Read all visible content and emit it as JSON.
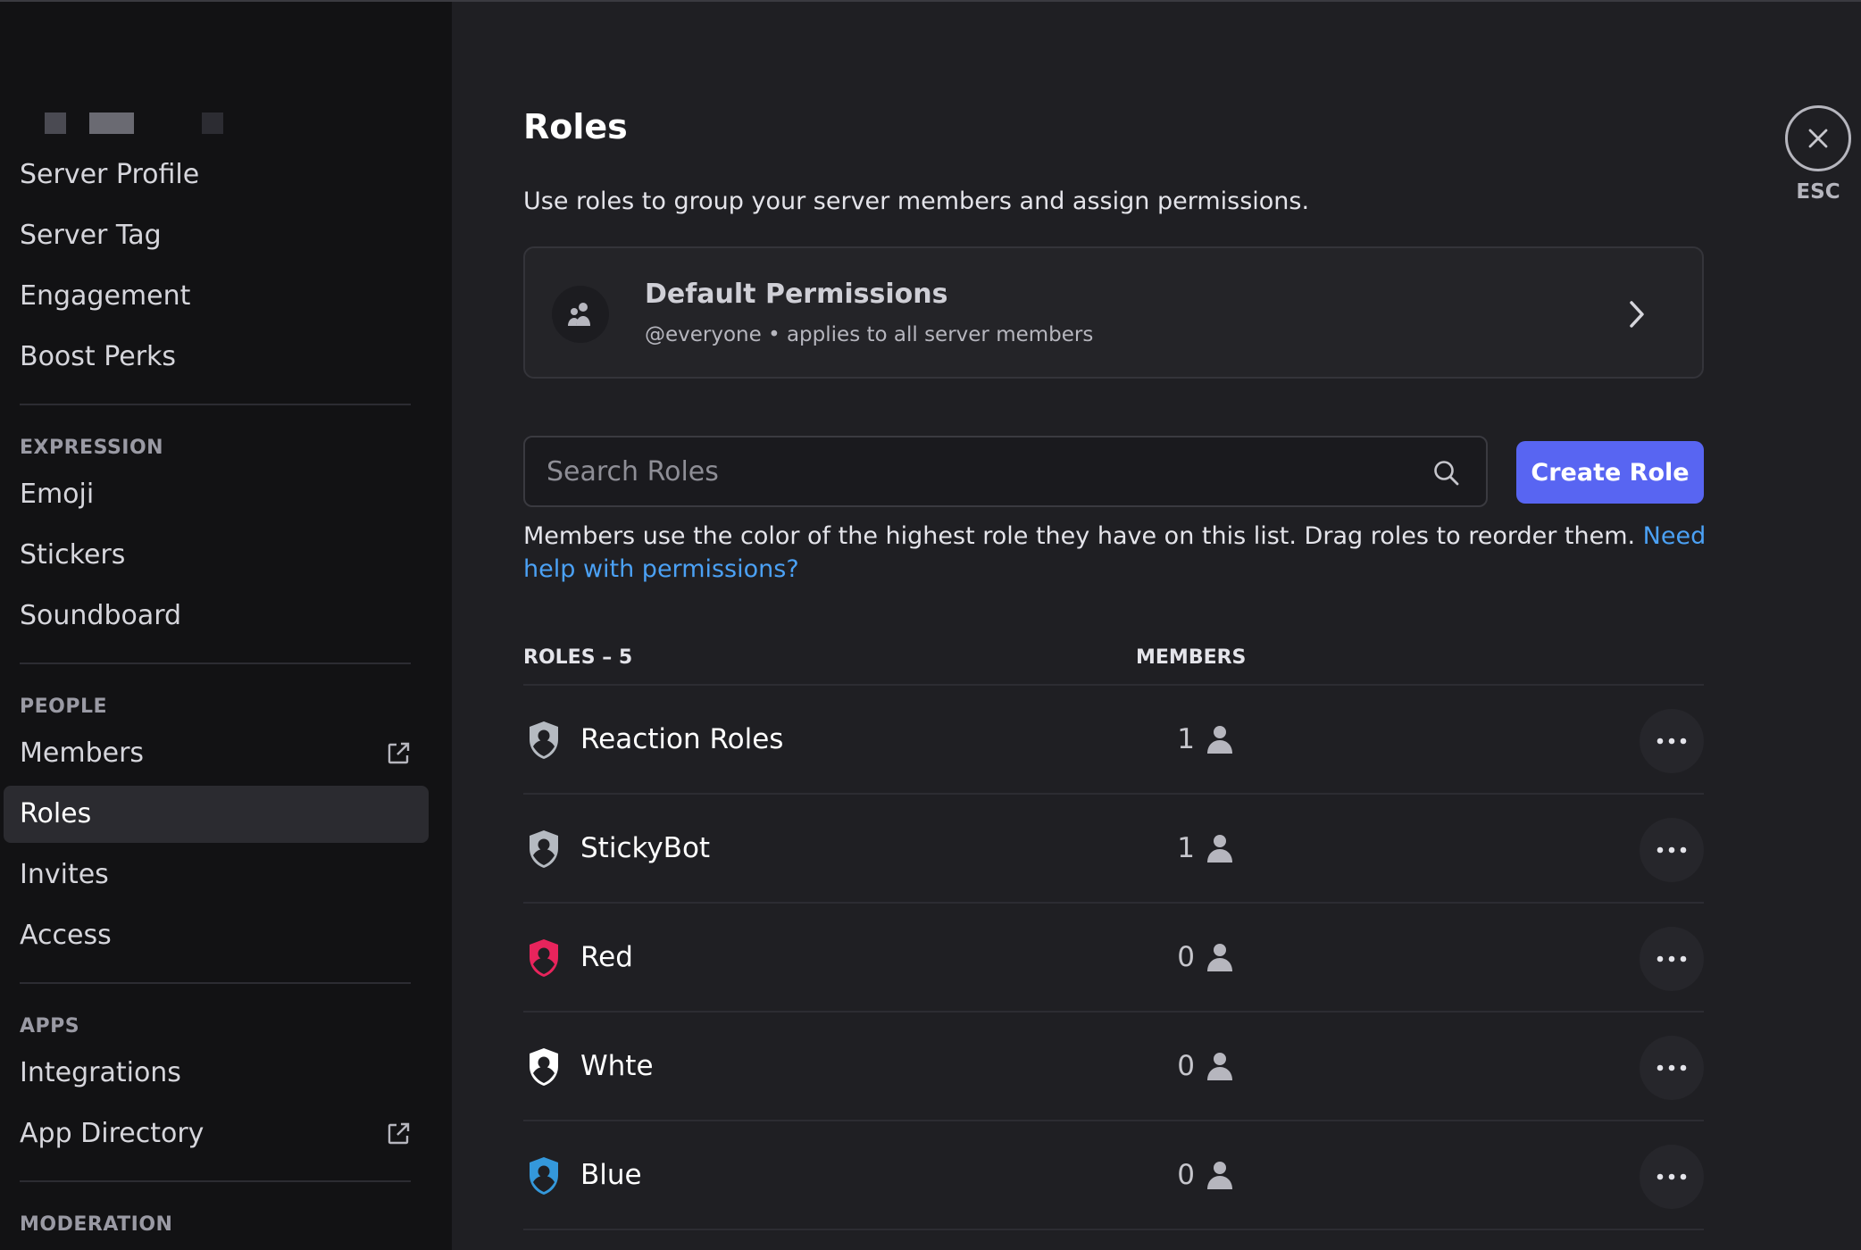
{
  "sidebar": {
    "items_top": [
      {
        "label": "Server Profile"
      },
      {
        "label": "Server Tag"
      },
      {
        "label": "Engagement"
      },
      {
        "label": "Boost Perks"
      }
    ],
    "expression": {
      "header": "EXPRESSION",
      "items": [
        {
          "label": "Emoji"
        },
        {
          "label": "Stickers"
        },
        {
          "label": "Soundboard"
        }
      ]
    },
    "people": {
      "header": "PEOPLE",
      "items": [
        {
          "label": "Members"
        },
        {
          "label": "Roles"
        },
        {
          "label": "Invites"
        },
        {
          "label": "Access"
        }
      ]
    },
    "apps": {
      "header": "APPS",
      "items": [
        {
          "label": "Integrations"
        },
        {
          "label": "App Directory"
        }
      ]
    },
    "moderation": {
      "header": "MODERATION"
    }
  },
  "main": {
    "title": "Roles",
    "description": "Use roles to group your server members and assign permissions.",
    "default_permissions": {
      "title": "Default Permissions",
      "subtitle": "@everyone • applies to all server members"
    },
    "search": {
      "placeholder": "Search Roles"
    },
    "create_button": "Create Role",
    "help_text": "Members use the color of the highest role they have on this list. Drag roles to reorder them. ",
    "help_link": "Need help with permissions?",
    "table": {
      "roles_header": "ROLES – 5",
      "members_header": "MEMBERS",
      "rows": [
        {
          "name": "Reaction Roles",
          "count": "1",
          "color": "#b5bac1"
        },
        {
          "name": "StickyBot",
          "count": "1",
          "color": "#b5bac1"
        },
        {
          "name": "Red",
          "count": "0",
          "color": "#e8245c"
        },
        {
          "name": "Whte",
          "count": "0",
          "color": "#ffffff"
        },
        {
          "name": "Blue",
          "count": "0",
          "color": "#3498db"
        }
      ]
    }
  },
  "close": {
    "label": "ESC"
  },
  "colors": {
    "accent": "#5865f2",
    "link": "#4ba1f5"
  }
}
